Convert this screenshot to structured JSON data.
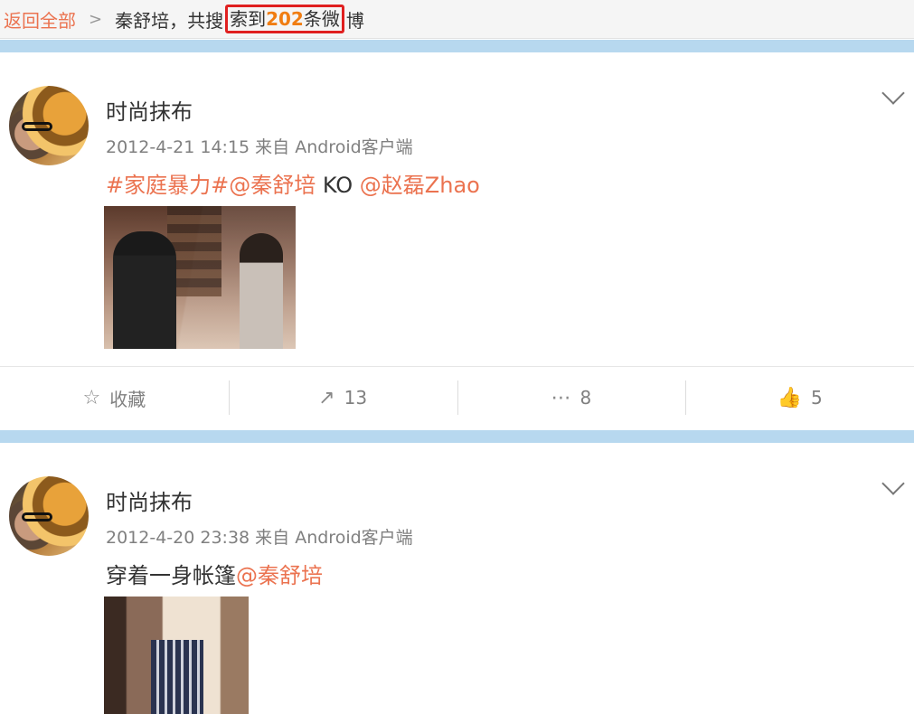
{
  "breadcrumb": {
    "back_label": "返回全部",
    "query_prefix": "秦舒培，共搜",
    "result_text_1": "索到",
    "result_count": "202",
    "result_text_2": "条微",
    "result_text_3": "博"
  },
  "posts": [
    {
      "username": "时尚抹布",
      "timestamp": "2012-4-21 14:15",
      "source": "来自 Android客户端",
      "content_parts": [
        {
          "text": "#家庭暴力#",
          "highlight": true
        },
        {
          "text": "@秦舒培",
          "highlight": true
        },
        {
          "text": " KO ",
          "highlight": false
        },
        {
          "text": "@赵磊Zhao",
          "highlight": true
        }
      ],
      "actions": {
        "favorite_label": "收藏",
        "repost_count": "13",
        "comment_count": "8",
        "like_count": "5"
      }
    },
    {
      "username": "时尚抹布",
      "timestamp": "2012-4-20 23:38",
      "source": "来自 Android客户端",
      "content_parts": [
        {
          "text": "穿着一身帐篷",
          "highlight": false
        },
        {
          "text": "@秦舒培",
          "highlight": true
        }
      ]
    }
  ],
  "colors": {
    "link_orange": "#eb7350",
    "count_orange": "#f07d12",
    "highlight_box": "#e02020",
    "separator_blue": "#b7d8ef"
  },
  "icons": {
    "favorite": "star-outline-icon",
    "repost": "share-arrow-icon",
    "comment": "comment-bubble-icon",
    "like": "thumbs-up-icon",
    "post_menu": "chevron-down-icon",
    "breadcrumb_sep": "chevron-right-icon"
  }
}
